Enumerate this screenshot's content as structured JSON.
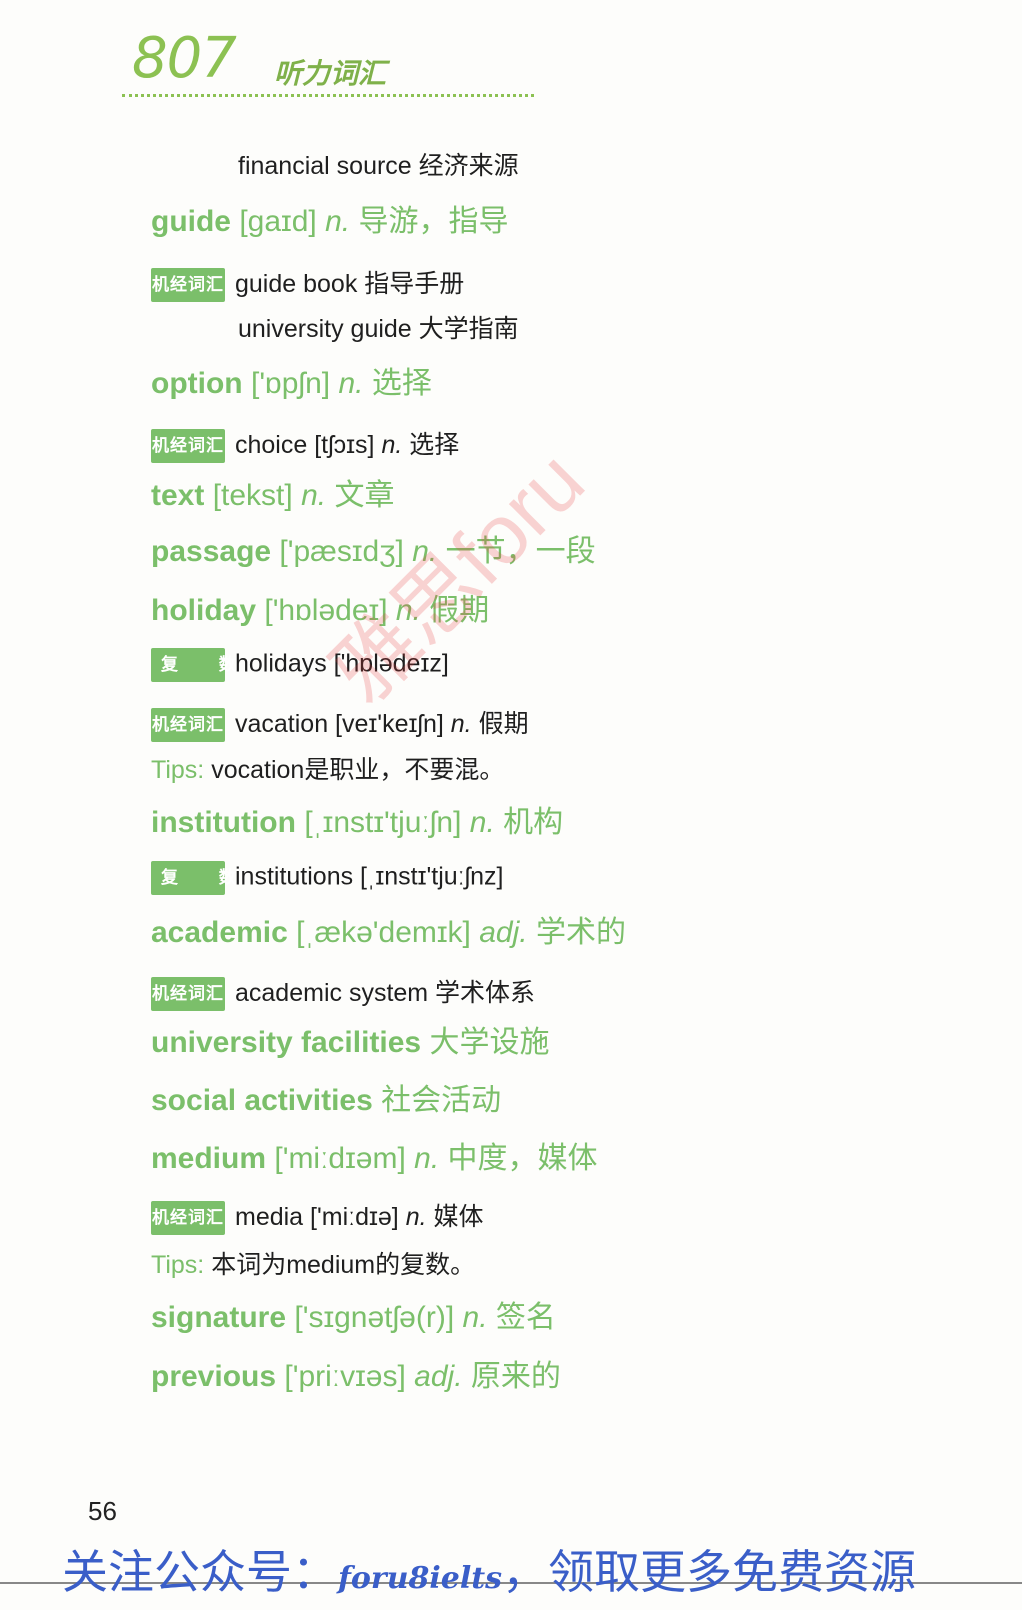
{
  "header": {
    "number": "807",
    "subtitle": "听力词汇"
  },
  "page_number": "56",
  "watermark": "雅思foru",
  "footer": {
    "before": "关注公众号：",
    "handle": "foru8ielts",
    "after": "，领取更多免费资源"
  },
  "entries": [
    {
      "type": "indent",
      "text": "financial source 经济来源"
    },
    {
      "type": "headword",
      "word": "guide",
      "phonetic": "[gaɪd]",
      "pos": "n.",
      "meaning": "导游，指导"
    },
    {
      "type": "sub",
      "badge": "机经词汇",
      "text": "guide book 指导手册"
    },
    {
      "type": "indent",
      "text": "university guide 大学指南"
    },
    {
      "type": "headword",
      "word": "option",
      "phonetic": "['ɒpʃn]",
      "pos": "n.",
      "meaning": "选择"
    },
    {
      "type": "sub",
      "badge": "机经词汇",
      "text": "choice [tʃɔɪs]",
      "pos": "n.",
      "meaning": "选择"
    },
    {
      "type": "headword",
      "word": "text",
      "phonetic": "[tekst]",
      "pos": "n.",
      "meaning": "文章"
    },
    {
      "type": "headword",
      "word": "passage",
      "phonetic": "['pæsɪdʒ]",
      "pos": "n.",
      "meaning": "一节，一段"
    },
    {
      "type": "headword",
      "word": "holiday",
      "phonetic": "['hɒlədeɪ]",
      "pos": "n.",
      "meaning": "假期"
    },
    {
      "type": "sub",
      "badge": "复 数",
      "text": "holidays ['hɒlədeɪz]"
    },
    {
      "type": "sub",
      "badge": "机经词汇",
      "text": "vacation [veɪ'keɪʃn]",
      "pos": "n.",
      "meaning": "假期"
    },
    {
      "type": "tips",
      "label": "Tips:",
      "text": "vocation是职业，不要混。"
    },
    {
      "type": "headword",
      "word": "institution",
      "phonetic": "[ˌɪnstɪ'tjuːʃn]",
      "pos": "n.",
      "meaning": "机构"
    },
    {
      "type": "sub",
      "badge": "复 数",
      "text": "institutions [ˌɪnstɪ'tjuːʃnz]"
    },
    {
      "type": "headword",
      "word": "academic",
      "phonetic": "[ˌækə'demɪk]",
      "pos": "adj.",
      "meaning": "学术的"
    },
    {
      "type": "sub",
      "badge": "机经词汇",
      "text": "academic system 学术体系"
    },
    {
      "type": "headword",
      "word": "university facilities",
      "meaning": "大学设施"
    },
    {
      "type": "headword",
      "word": "social activities",
      "meaning": "社会活动"
    },
    {
      "type": "headword",
      "word": "medium",
      "phonetic": "['miːdɪəm]",
      "pos": "n.",
      "meaning": "中度，媒体"
    },
    {
      "type": "sub",
      "badge": "机经词汇",
      "text": "media ['miːdɪə]",
      "pos": "n.",
      "meaning": "媒体"
    },
    {
      "type": "tips",
      "label": "Tips:",
      "text": "本词为medium的复数。"
    },
    {
      "type": "headword",
      "word": "signature",
      "phonetic": "['sɪgnətʃə(r)]",
      "pos": "n.",
      "meaning": "签名"
    },
    {
      "type": "headword",
      "word": "previous",
      "phonetic": "['priːvɪəs]",
      "pos": "adj.",
      "meaning": "原来的"
    }
  ]
}
